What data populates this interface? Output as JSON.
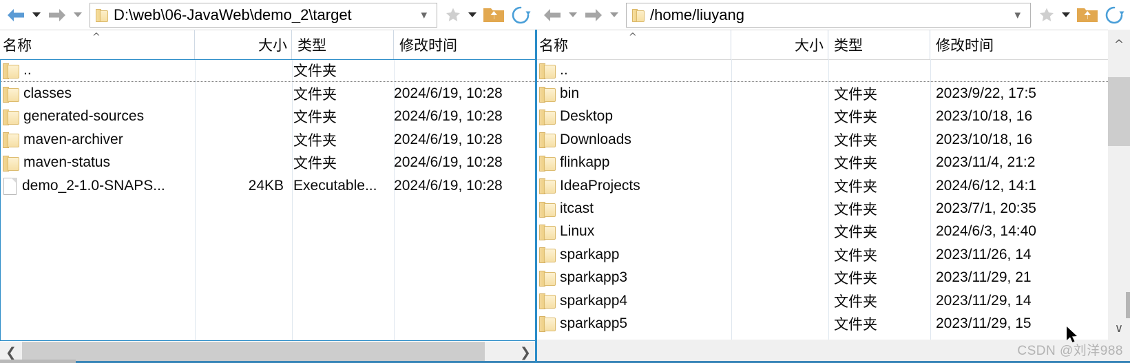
{
  "left_pane": {
    "toolbar": {
      "back_icon": "arrow-left-icon",
      "back_dropdown_icon": "caret-down-icon",
      "forward_icon": "arrow-right-icon",
      "forward_dropdown_icon": "caret-down-icon",
      "folder_icon": "folder-icon",
      "address_value": "D:\\web\\06-JavaWeb\\demo_2\\target",
      "address_chevron_icon": "chevron-down-icon",
      "star_icon": "star-icon",
      "star_dropdown_icon": "caret-down-icon",
      "home_icon": "folder-up-icon",
      "refresh_icon": "refresh-icon"
    },
    "columns": [
      {
        "key": "name",
        "label": "名称",
        "sort_indicator": "^"
      },
      {
        "key": "size",
        "label": "大小",
        "sort_indicator": ""
      },
      {
        "key": "type",
        "label": "类型",
        "sort_indicator": ""
      },
      {
        "key": "mod",
        "label": "修改时间",
        "sort_indicator": ""
      }
    ],
    "rows": [
      {
        "icon": "folder-icon",
        "name": "..",
        "size": "",
        "type": "文件夹",
        "mod": "",
        "is_parent": true
      },
      {
        "icon": "folder-icon",
        "name": "classes",
        "size": "",
        "type": "文件夹",
        "mod": "2024/6/19, 10:28",
        "is_parent": false
      },
      {
        "icon": "folder-icon",
        "name": "generated-sources",
        "size": "",
        "type": "文件夹",
        "mod": "2024/6/19, 10:28",
        "is_parent": false
      },
      {
        "icon": "folder-icon",
        "name": "maven-archiver",
        "size": "",
        "type": "文件夹",
        "mod": "2024/6/19, 10:28",
        "is_parent": false
      },
      {
        "icon": "folder-icon",
        "name": "maven-status",
        "size": "",
        "type": "文件夹",
        "mod": "2024/6/19, 10:28",
        "is_parent": false
      },
      {
        "icon": "file-icon",
        "name": "demo_2-1.0-SNAPS...",
        "size": "24KB",
        "type": "Executable...",
        "mod": "2024/6/19, 10:28",
        "is_parent": false
      }
    ],
    "hscrollbar": {
      "left_arrow_icon": "chevron-left-icon",
      "right_arrow_icon": "chevron-right-icon"
    }
  },
  "right_pane": {
    "toolbar": {
      "back_icon": "arrow-left-icon",
      "back_dropdown_icon": "caret-down-icon",
      "forward_icon": "arrow-right-icon",
      "forward_dropdown_icon": "caret-down-icon",
      "folder_icon": "folder-icon",
      "address_value": "/home/liuyang",
      "address_chevron_icon": "chevron-down-icon",
      "star_icon": "star-icon",
      "star_dropdown_icon": "caret-down-icon",
      "home_icon": "folder-up-icon",
      "refresh_icon": "refresh-icon"
    },
    "columns": [
      {
        "key": "name",
        "label": "名称",
        "sort_indicator": "^"
      },
      {
        "key": "size",
        "label": "大小",
        "sort_indicator": ""
      },
      {
        "key": "type",
        "label": "类型",
        "sort_indicator": ""
      },
      {
        "key": "mod",
        "label": "修改时间",
        "sort_indicator": ""
      }
    ],
    "rows": [
      {
        "icon": "folder-icon",
        "name": "..",
        "size": "",
        "type": "",
        "mod": "",
        "is_parent": true
      },
      {
        "icon": "folder-icon",
        "name": "bin",
        "size": "",
        "type": "文件夹",
        "mod": "2023/9/22, 17:5",
        "is_parent": false
      },
      {
        "icon": "folder-icon",
        "name": "Desktop",
        "size": "",
        "type": "文件夹",
        "mod": "2023/10/18, 16",
        "is_parent": false
      },
      {
        "icon": "folder-icon",
        "name": "Downloads",
        "size": "",
        "type": "文件夹",
        "mod": "2023/10/18, 16",
        "is_parent": false
      },
      {
        "icon": "folder-icon",
        "name": "flinkapp",
        "size": "",
        "type": "文件夹",
        "mod": "2023/11/4, 21:2",
        "is_parent": false
      },
      {
        "icon": "folder-icon",
        "name": "IdeaProjects",
        "size": "",
        "type": "文件夹",
        "mod": "2024/6/12, 14:1",
        "is_parent": false
      },
      {
        "icon": "folder-icon",
        "name": "itcast",
        "size": "",
        "type": "文件夹",
        "mod": "2023/7/1, 20:35",
        "is_parent": false
      },
      {
        "icon": "folder-icon",
        "name": "Linux",
        "size": "",
        "type": "文件夹",
        "mod": "2024/6/3, 14:40",
        "is_parent": false
      },
      {
        "icon": "folder-icon",
        "name": "sparkapp",
        "size": "",
        "type": "文件夹",
        "mod": "2023/11/26, 14",
        "is_parent": false
      },
      {
        "icon": "folder-icon",
        "name": "sparkapp3",
        "size": "",
        "type": "文件夹",
        "mod": "2023/11/29, 21",
        "is_parent": false
      },
      {
        "icon": "folder-icon",
        "name": "sparkapp4",
        "size": "",
        "type": "文件夹",
        "mod": "2023/11/29, 14",
        "is_parent": false
      },
      {
        "icon": "folder-icon",
        "name": "sparkapp5",
        "size": "",
        "type": "文件夹",
        "mod": "2023/11/29, 15",
        "is_parent": false
      }
    ],
    "vscrollbar": {
      "up_arrow_icon": "chevron-up-icon",
      "down_arrow_icon": "chevron-down-icon"
    }
  },
  "watermark": {
    "text": "CSDN @刘洋988"
  },
  "colors": {
    "accent_blue": "#2a8cc8",
    "folder_yellow": "#f3d89a",
    "back_arrow_blue": "#5b9bd5",
    "forward_arrow_gray": "#a6a6a6",
    "scrollbar_thumb": "#cdcdcd",
    "header_text": "#0b0b0b"
  }
}
